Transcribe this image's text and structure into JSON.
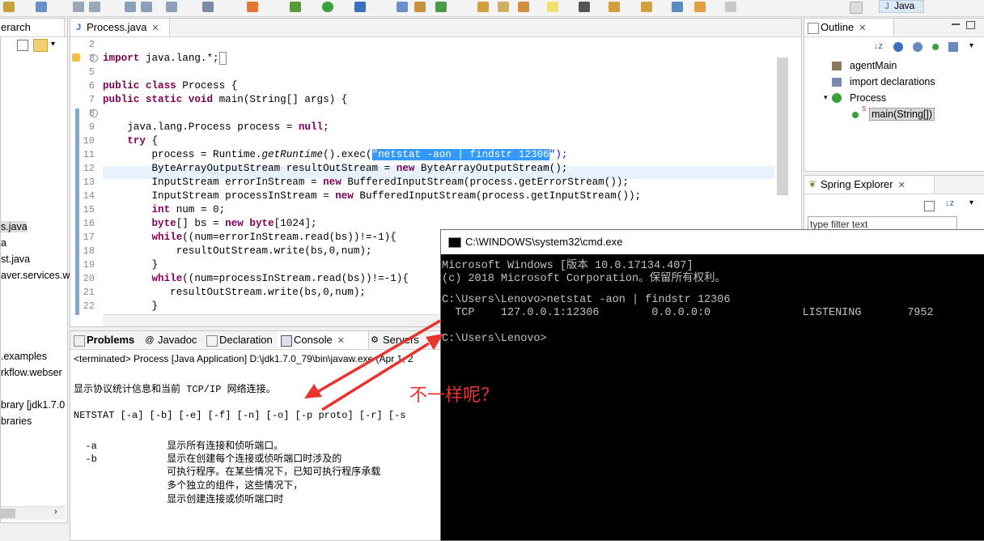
{
  "toolbar": {
    "perspective_label": "Java"
  },
  "left_panel": {
    "tab_label": "erarch",
    "items": [
      "s.java",
      "a",
      "st.java",
      "aver.services.w",
      ".examples",
      "rkflow.webser",
      "brary [jdk1.7.0",
      "braries"
    ]
  },
  "editor": {
    "tab_label": "Process.java",
    "line_numbers": [
      "2",
      "3",
      "5",
      "6",
      "7",
      "8",
      "9",
      "10",
      "11",
      "12",
      "13",
      "14",
      "15",
      "16",
      "17",
      "18",
      "19",
      "20",
      "21",
      "22"
    ],
    "lines": {
      "l2": "",
      "l3a": "import",
      "l3b": " java.lang.*;",
      "l5": "",
      "l6a": "public class",
      "l6b": " Process {",
      "l7a": "public static void",
      "l7b": " main(String[] args) {",
      "l9a": "    java.lang.Process process = ",
      "l9b": "null",
      "l9c": ";",
      "l10a": "    try",
      "l10b": " {",
      "l11a": "        process = Runtime.",
      "l11b": "getRuntime",
      "l11c": "().exec(",
      "l11d": "\"netstat -aon | findstr 12306",
      "l11e": "\");",
      "l12a": "        ByteArrayOutputStream resultOutStream = ",
      "l12b": "new",
      "l12c": " ByteArrayOutputStream();",
      "l13a": "        InputStream errorInStream = ",
      "l13b": "new",
      "l13c": " BufferedInputStream(process.getErrorStream());",
      "l14a": "        InputStream processInStream = ",
      "l14b": "new",
      "l14c": " BufferedInputStream(process.getInputStream());",
      "l15a": "        int",
      "l15b": " num = 0;",
      "l16a": "        byte",
      "l16b": "[] bs = ",
      "l16c": "new",
      "l16d": " byte",
      "l16e": "[1024];",
      "l17a": "        while",
      "l17b": "((num=errorInStream.read(bs))!=-1){",
      "l18": "            resultOutStream.write(bs,0,num);",
      "l19": "        }",
      "l20a": "        while",
      "l20b": "((num=processInStream.read(bs))!=-1){",
      "l21": "           resultOutStream.write(bs,0,num);",
      "l22": "        }"
    }
  },
  "console": {
    "tabs": [
      "Problems",
      "Javadoc",
      "Declaration",
      "Console",
      "Servers"
    ],
    "terminated": "<terminated> Process [Java Application] D:\\jdk1.7.0_79\\bin\\javaw.exe (Apr 1, 2",
    "lines": [
      "显示协议统计信息和当前 TCP/IP 网络连接。",
      "NETSTAT [-a] [-b] [-e] [-f] [-n] [-o] [-p proto] [-r] [-s",
      "  -a            显示所有连接和侦听端口。",
      "  -b            显示在创建每个连接或侦听端口时涉及的",
      "                可执行程序。在某些情况下，已知可执行程序承载",
      "                多个独立的组件，这些情况下，",
      "                显示创建连接或侦听端口时"
    ]
  },
  "outline": {
    "tab_label": "Outline",
    "items": [
      "agentMain",
      "import declarations",
      "Process",
      "main(String[])"
    ]
  },
  "spring": {
    "tab_label": "Spring Explorer",
    "filter_placeholder": "type filter text"
  },
  "cmd": {
    "title": "C:\\WINDOWS\\system32\\cmd.exe",
    "lines": [
      "Microsoft Windows [版本 10.0.17134.407]",
      "(c) 2018 Microsoft Corporation。保留所有权利。",
      "",
      "C:\\Users\\Lenovo>netstat -aon | findstr 12306",
      "  TCP    127.0.0.1:12306        0.0.0.0:0              LISTENING       7952",
      "",
      "C:\\Users\\Lenovo>"
    ]
  },
  "annotation": {
    "text": "不一样呢？",
    "color": "#e8332f"
  }
}
